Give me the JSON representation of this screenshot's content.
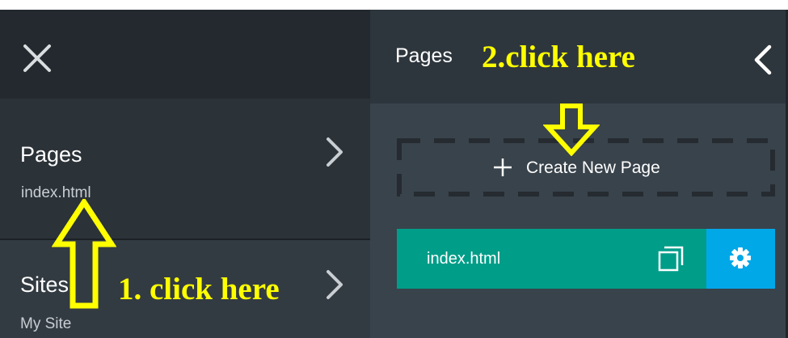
{
  "sidebar": {
    "close_icon": "close-icon",
    "items": [
      {
        "label": "Pages",
        "sub": "index.html",
        "icon": "chevron-right-icon"
      },
      {
        "label": "Sites",
        "sub": "My Site",
        "icon": "chevron-right-icon"
      }
    ]
  },
  "pages_panel": {
    "title": "Pages",
    "back_icon": "chevron-left-icon",
    "create_label": "Create New Page",
    "create_icon": "plus-icon",
    "pages": [
      {
        "label": "index.html",
        "duplicate_icon": "duplicate-icon",
        "settings_icon": "gear-icon"
      }
    ]
  },
  "annotations": {
    "step1": "1. click here",
    "step2": "2.click here",
    "color": "#ffff00"
  },
  "colors": {
    "sidebar_dark": "#23292f",
    "sidebar_item": "#2b3238",
    "sidebar_item_alt": "#333b42",
    "panel_header": "#2e363d",
    "panel_body": "#39434b",
    "page_row": "#009d88",
    "settings": "#00a8e8"
  }
}
